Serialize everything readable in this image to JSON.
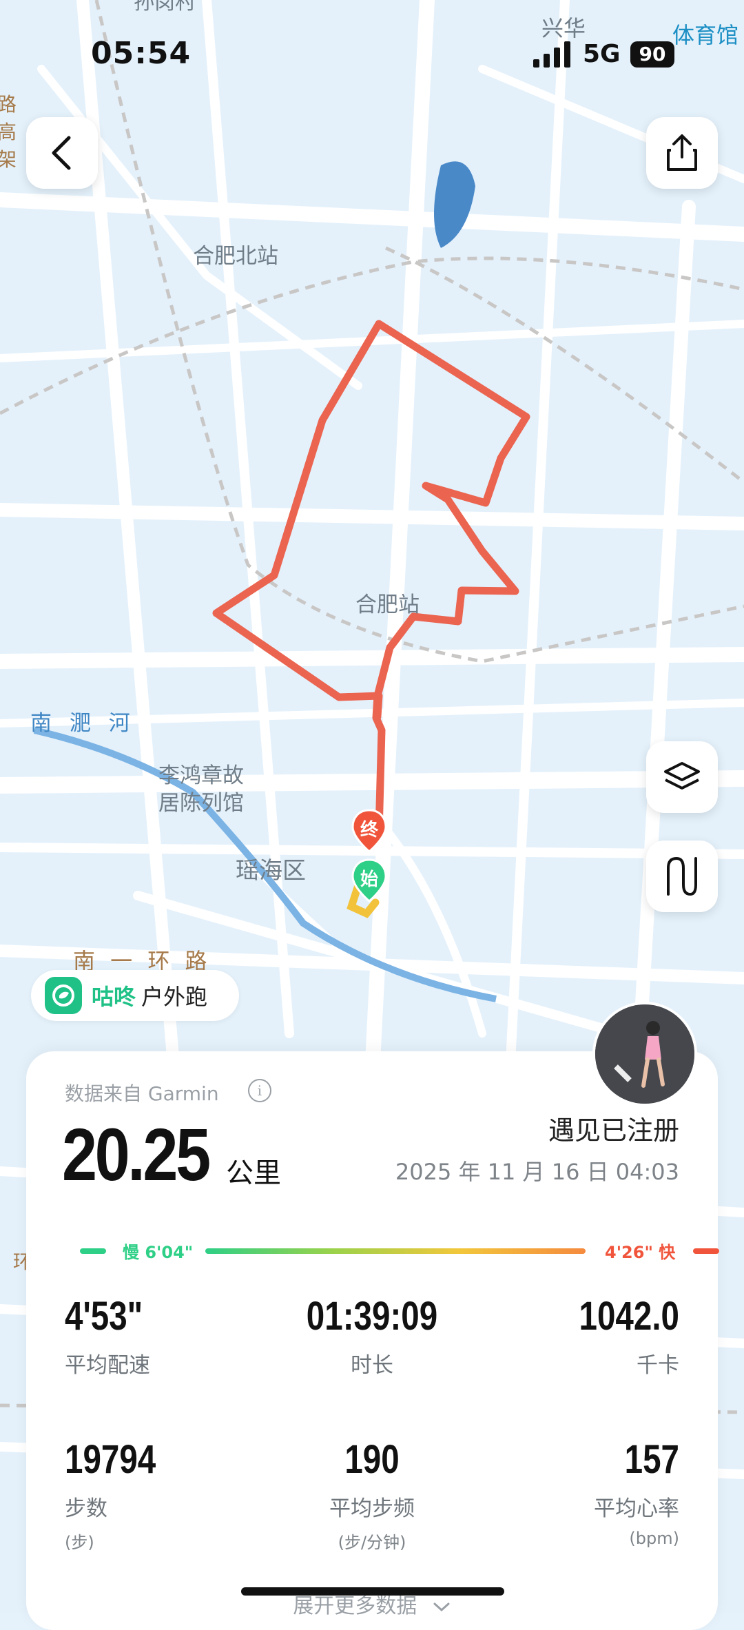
{
  "status_bar": {
    "time": "05:54",
    "network": "5G",
    "battery": "90"
  },
  "map": {
    "labels": {
      "hefei_north": "合肥北站",
      "hefei_station": "合肥站",
      "nanfei_river": "南 淝 河",
      "li_museum_1": "李鸿章故",
      "li_museum_2": "居陈列馆",
      "yaohai": "瑶海区",
      "ring_road": "南 一 环 路",
      "xinghua": "兴华",
      "stadium": "体育馆",
      "partial_top": "孙岗村",
      "partial_left": "路高架",
      "partial_left2": "二 环"
    },
    "end_marker": "终",
    "start_marker": "始"
  },
  "app": {
    "brand": "咕咚",
    "activity": "户外跑"
  },
  "summary": {
    "source": "数据来自 Garmin",
    "distance": "20.25",
    "distance_unit": "公里",
    "status": "遇见已注册",
    "date": "2025 年 11 月 16 日 04:03",
    "pace_slow": "慢 6'04\"",
    "pace_fast": "4'26\" 快"
  },
  "stats": [
    {
      "value": "4'53\"",
      "label": "平均配速",
      "sub": ""
    },
    {
      "value": "01:39:09",
      "label": "时长",
      "sub": ""
    },
    {
      "value": "1042.0",
      "label": "千卡",
      "sub": ""
    },
    {
      "value": "19794",
      "label": "步数",
      "sub": "(步)"
    },
    {
      "value": "190",
      "label": "平均步频",
      "sub": "(步/分钟)"
    },
    {
      "value": "157",
      "label": "平均心率",
      "sub": "(bpm)"
    }
  ],
  "expand_more": "展开更多数据",
  "colors": {
    "route": "#eb6450",
    "start": "#2ecf86",
    "end": "#f0553c",
    "accent": "#1fc187"
  }
}
